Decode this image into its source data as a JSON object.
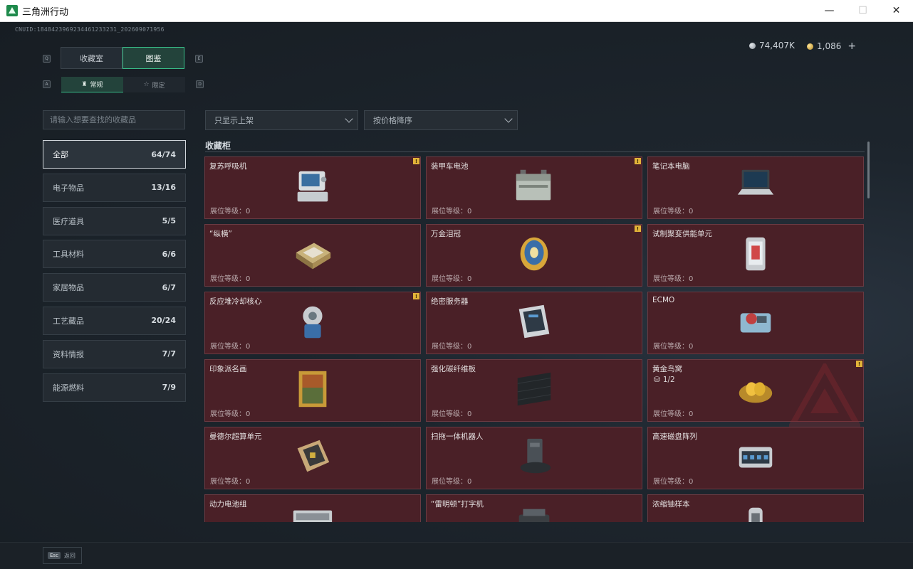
{
  "window": {
    "title": "三角洲行动",
    "controls": {
      "minimize": "—",
      "maximize": "☐",
      "close": "✕"
    }
  },
  "header": {
    "uid": "CNUID:1848423969234461233231_202609071956",
    "currency_silver": "74,407K",
    "currency_gold": "1,086",
    "add_symbol": "+"
  },
  "tabs": {
    "key_left": "Q",
    "key_right": "E",
    "items": [
      {
        "label": "收藏室",
        "active": false
      },
      {
        "label": "图鉴",
        "active": true
      }
    ]
  },
  "subtabs": {
    "key_left": "A",
    "key_right": "D",
    "items": [
      {
        "label": "常规",
        "active": true
      },
      {
        "label": "限定",
        "active": false
      }
    ]
  },
  "search": {
    "placeholder": "请输入想要查找的收藏品",
    "value": ""
  },
  "filters": {
    "shelf": "只显示上架",
    "sort": "按价格降序"
  },
  "categories": [
    {
      "label": "全部",
      "count": "64/74",
      "active": true
    },
    {
      "label": "电子物品",
      "count": "13/16"
    },
    {
      "label": "医疗道具",
      "count": "5/5"
    },
    {
      "label": "工具材料",
      "count": "6/6"
    },
    {
      "label": "家居物品",
      "count": "6/7"
    },
    {
      "label": "工艺藏品",
      "count": "20/24"
    },
    {
      "label": "资料情报",
      "count": "7/7"
    },
    {
      "label": "能源燃料",
      "count": "7/9"
    }
  ],
  "section": {
    "title": "收藏柜"
  },
  "level_label": "展位等级：0",
  "items": [
    {
      "name": "复苏呼吸机",
      "flag": "!",
      "icon": "ventilator-icon"
    },
    {
      "name": "装甲车电池",
      "flag": "!",
      "icon": "battery-icon"
    },
    {
      "name": "笔记本电脑",
      "icon": "laptop-icon"
    },
    {
      "name": "“纵横”",
      "icon": "chessboard-icon"
    },
    {
      "name": "万金泪冠",
      "flag": "!",
      "icon": "jeweled-egg-icon"
    },
    {
      "name": "试制聚变供能单元",
      "icon": "fusion-unit-icon"
    },
    {
      "name": "反应堆冷却核心",
      "flag": "!",
      "icon": "reactor-core-icon"
    },
    {
      "name": "绝密服务器",
      "icon": "server-icon"
    },
    {
      "name": "ECMO",
      "icon": "ecmo-icon"
    },
    {
      "name": "印象派名画",
      "icon": "painting-icon"
    },
    {
      "name": "强化碳纤维板",
      "icon": "carbon-plate-icon"
    },
    {
      "name": "黄金鸟窝",
      "flag": "!",
      "progress": "1/2",
      "icon": "golden-nest-icon"
    },
    {
      "name": "曼德尔超算单元",
      "icon": "supercomputer-chip-icon"
    },
    {
      "name": "扫拖一体机器人",
      "icon": "robot-vacuum-icon"
    },
    {
      "name": "高速磁盘阵列",
      "icon": "disk-array-icon"
    },
    {
      "name": "动力电池组",
      "icon": "battery-pack-icon"
    },
    {
      "name": "“雷明顿”打字机",
      "icon": "typewriter-icon"
    },
    {
      "name": "浓缩铀样本",
      "icon": "uranium-sample-icon"
    }
  ],
  "footer": {
    "esc_key": "Esc",
    "back_label": "返回"
  }
}
